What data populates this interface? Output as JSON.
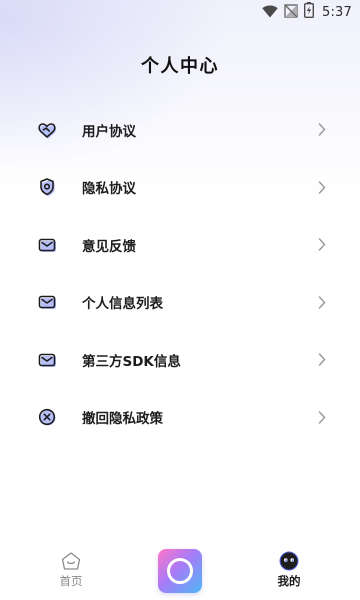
{
  "status_bar": {
    "time": "5:37",
    "icons": [
      "wifi-icon",
      "signal-off-icon",
      "battery-charging-icon"
    ]
  },
  "header": {
    "title": "个人中心"
  },
  "menu": {
    "items": [
      {
        "label": "用户协议",
        "icon": "handshake-icon"
      },
      {
        "label": "隐私协议",
        "icon": "shield-icon"
      },
      {
        "label": "意见反馈",
        "icon": "mail-icon"
      },
      {
        "label": "个人信息列表",
        "icon": "mail-icon"
      },
      {
        "label": "第三方SDK信息",
        "icon": "mail-icon"
      },
      {
        "label": "撤回隐私政策",
        "icon": "close-circle-icon"
      }
    ]
  },
  "bottom_nav": {
    "home_label": "首页",
    "camera_icon": "camera-icon",
    "mine_label": "我的",
    "active_tab": "我的"
  },
  "colors": {
    "accent_blue": "#5a6cf0",
    "accent_shadow": "#b7bff8",
    "chevron": "#9a9a9a",
    "camera_gradient": [
      "#ff76c8",
      "#a77bf7",
      "#4fb7f7"
    ]
  }
}
